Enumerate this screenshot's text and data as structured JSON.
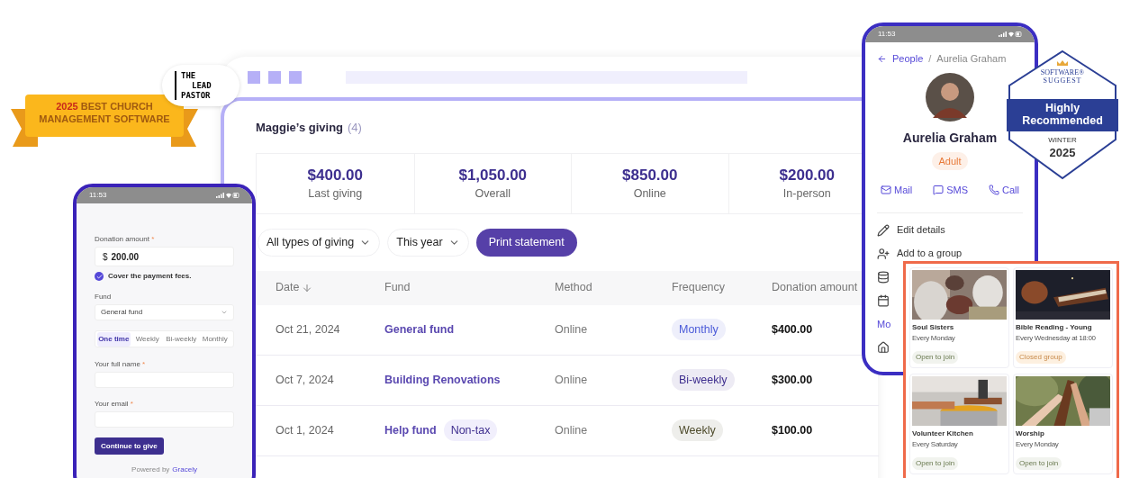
{
  "award_ribbon": {
    "year": "2025",
    "line_1": "BEST CHURCH",
    "line_2": "MANAGEMENT SOFTWARE"
  },
  "publisher_logo": {
    "lines": [
      "THE",
      "LEAD",
      "PASTOR"
    ]
  },
  "recommendation_badge": {
    "brand_line_1": "SOFTWARE®",
    "brand_line_2": "SUGGEST",
    "title": "Highly Recommended",
    "season": "WINTER",
    "year": "2025"
  },
  "giving": {
    "title": "Maggie’s giving",
    "count": "(4)",
    "stats": [
      {
        "value": "$400.00",
        "label": "Last giving"
      },
      {
        "value": "$1,050.00",
        "label": "Overall"
      },
      {
        "value": "$850.00",
        "label": "Online"
      },
      {
        "value": "$200.00",
        "label": "In-person"
      }
    ],
    "filters": [
      "All types of giving",
      "This year"
    ],
    "print_button": "Print statement",
    "table": {
      "columns": [
        "Date",
        "Fund",
        "Method",
        "Frequency",
        "Donation amount"
      ],
      "rows": [
        {
          "date": "Oct 21, 2024",
          "fund": "General fund",
          "method": "Online",
          "frequency": {
            "label": "Monthly",
            "color": "#4a5ad8"
          },
          "amount": "$400.00"
        },
        {
          "date": "Oct 7, 2024",
          "fund": "Building Renovations",
          "method": "Online",
          "frequency": {
            "label": "Bi-weekly",
            "color": "#3f2f8f"
          },
          "amount": "$300.00"
        },
        {
          "date": "Oct 1, 2024",
          "fund": "Help fund",
          "tag": "Non-tax",
          "method": "Online",
          "frequency": {
            "label": "Weekly",
            "color": "#4d4a2a"
          },
          "amount": "$100.00"
        }
      ]
    }
  },
  "donation_phone": {
    "time": "11:53",
    "amount_field": {
      "label": "Donation amount",
      "required_mark": "*",
      "currency": "$",
      "value": "200.00"
    },
    "cover_fees": {
      "label": "Cover the payment fees.",
      "checked": true
    },
    "fund_field": {
      "label": "Fund",
      "value": "General fund"
    },
    "frequency_tabs": [
      {
        "label": "One time",
        "selected": true
      },
      {
        "label": "Weekly",
        "selected": false
      },
      {
        "label": "Bi-weekly",
        "selected": false
      },
      {
        "label": "Monthly",
        "selected": false
      }
    ],
    "name_field": {
      "label": "Your full name",
      "required_mark": "*"
    },
    "email_field": {
      "label": "Your email",
      "required_mark": "*"
    },
    "submit_button": "Continue to give",
    "footer": {
      "prefix": "Powered by",
      "link": "Gracely"
    }
  },
  "profile_phone": {
    "time": "11:53",
    "breadcrumb": {
      "parent": "People",
      "separator": "/",
      "current": "Aurelia Graham"
    },
    "name": "Aurelia Graham",
    "role": "Adult",
    "contact_actions": [
      "Mail",
      "SMS",
      "Call"
    ],
    "menu": [
      {
        "kind": "item",
        "label": "Edit details"
      },
      {
        "kind": "item",
        "label": "Add to a group"
      },
      {
        "kind": "icon_only"
      },
      {
        "kind": "icon_only"
      },
      {
        "kind": "link",
        "label": "Mo"
      },
      {
        "kind": "icon_only"
      }
    ]
  },
  "groups": [
    {
      "name": "Soul Sisters",
      "schedule": "Every Monday",
      "status": {
        "kind": "open",
        "label": "Open to join"
      }
    },
    {
      "name": "Bible Reading - Young",
      "schedule": "Every Wednesday at 18:00",
      "status": {
        "kind": "closed",
        "label": "Closed group"
      }
    },
    {
      "name": "Volunteer Kitchen",
      "schedule": "Every Saturday",
      "status": {
        "kind": "open",
        "label": "Open to join"
      }
    },
    {
      "name": "Worship",
      "schedule": "Every Monday",
      "status": {
        "kind": "open",
        "label": "Open to join"
      }
    }
  ]
}
